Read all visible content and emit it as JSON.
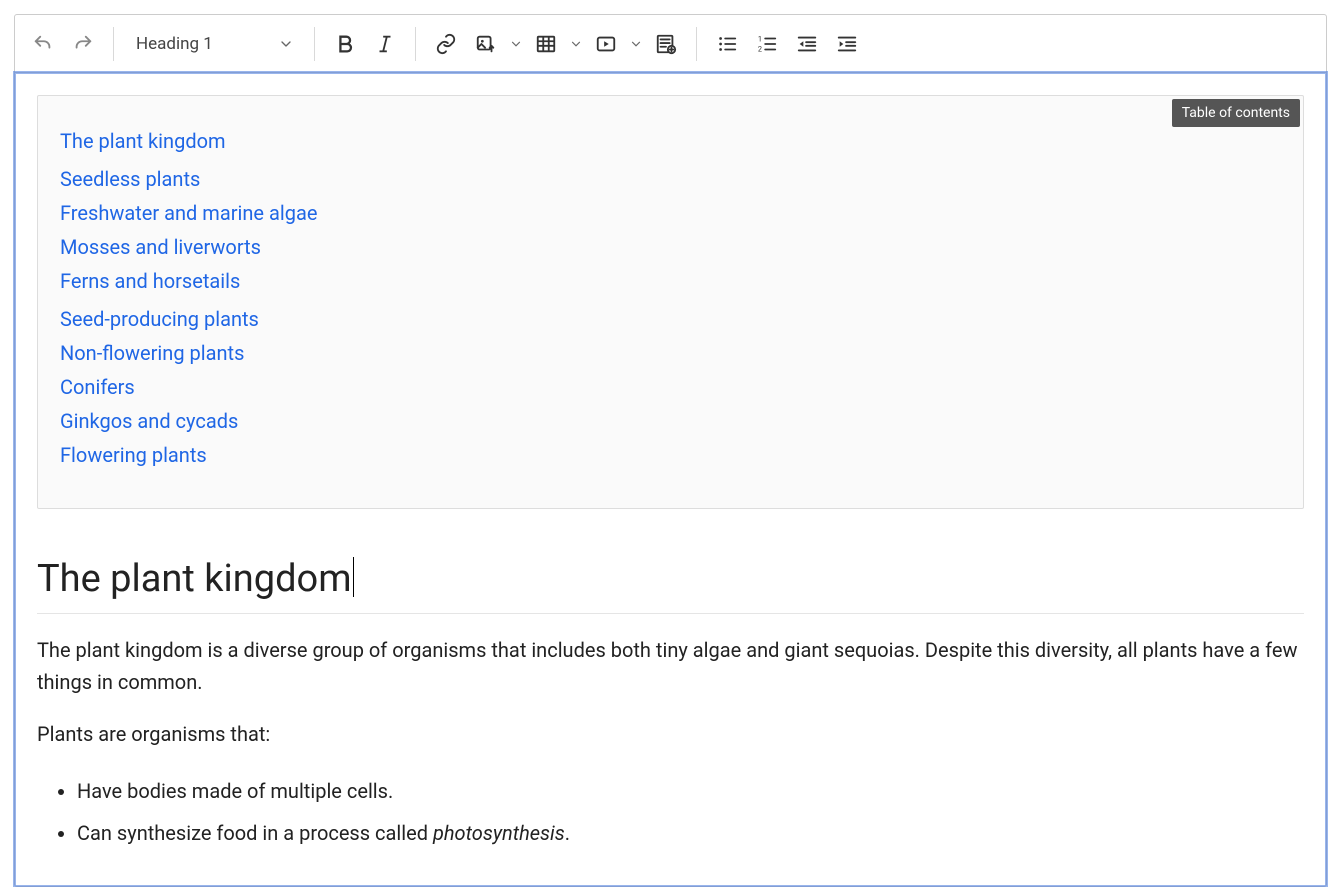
{
  "toolbar": {
    "heading_select": "Heading 1"
  },
  "toc": {
    "badge": "Table of contents",
    "items": [
      {
        "level": 1,
        "label": "The plant kingdom"
      },
      {
        "level": 2,
        "label": "Seedless plants"
      },
      {
        "level": 3,
        "label": "Freshwater and marine algae"
      },
      {
        "level": 3,
        "label": "Mosses and liverworts"
      },
      {
        "level": 3,
        "label": "Ferns and horsetails"
      },
      {
        "level": 2,
        "label": "Seed-producing plants"
      },
      {
        "level": 3,
        "label": "Non-flowering plants"
      },
      {
        "level": 4,
        "label": "Conifers"
      },
      {
        "level": 4,
        "label": "Ginkgos and cycads"
      },
      {
        "level": 3,
        "label": "Flowering plants"
      }
    ]
  },
  "doc": {
    "h1": "The plant kingdom",
    "p1": "The plant kingdom is a diverse group of organisms that includes both tiny algae and giant sequoias. Despite this diversity, all plants have a few things in common.",
    "p2": "Plants are organisms that:",
    "bullets": [
      {
        "plain": "Have bodies made of multiple cells."
      },
      {
        "plain_prefix": "Can synthesize food in a process called ",
        "italic": "photosynthesis",
        "plain_suffix": "."
      }
    ]
  }
}
